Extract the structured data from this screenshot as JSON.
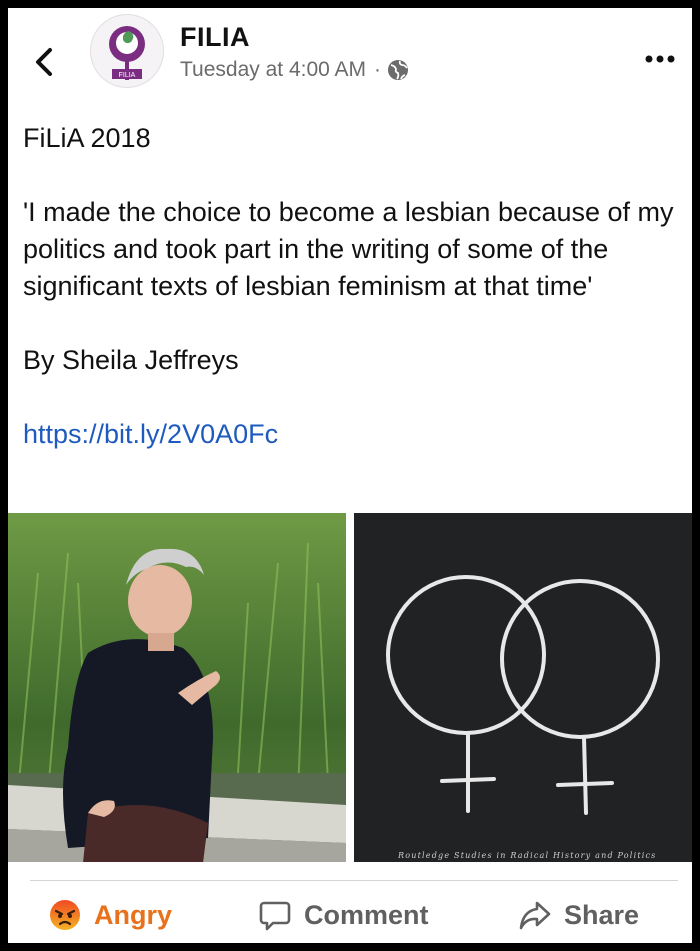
{
  "header": {
    "page_name": "FILIA",
    "timestamp": "Tuesday at 4:00 AM",
    "separator": "·",
    "avatar_text": "FILIA",
    "icons": {
      "back": "chevron-left-icon",
      "audience": "globe-icon",
      "more": "more-horizontal-icon"
    }
  },
  "post": {
    "line1": "FiLiA 2018",
    "quote": "'I made the choice to become a lesbian because of my politics and took part in the writing of some of the significant texts of lesbian feminism at that time'",
    "author": "By Sheila Jeffreys",
    "link": "https://bit.ly/2V0A0Fc"
  },
  "images": {
    "right_caption": "Routledge Studies in Radical History and Politics"
  },
  "actions": {
    "angry": "Angry",
    "comment": "Comment",
    "share": "Share"
  },
  "colors": {
    "link": "#1f5bbf",
    "angry": "#e8711b",
    "action_gray": "#606060",
    "brand_purple": "#7b2d82"
  }
}
